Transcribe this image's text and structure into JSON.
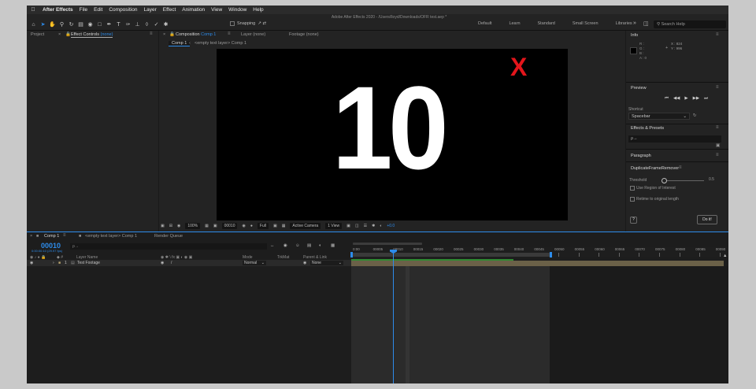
{
  "menubar": {
    "app_name": "After Effects",
    "items": [
      "File",
      "Edit",
      "Composition",
      "Layer",
      "Effect",
      "Animation",
      "View",
      "Window",
      "Help"
    ]
  },
  "window_title": "Adobe After Effects 2020 - /Users/lloyd/Downloads/OFR test.aep *",
  "toolbar": {
    "snapping_label": "Snapping",
    "workspaces": [
      "Default",
      "Learn",
      "Standard",
      "Small Screen",
      "Libraries"
    ],
    "search_placeholder": "Search Help"
  },
  "project_panel": {
    "tab": "Project"
  },
  "effect_controls": {
    "tab_prefix": "Effect Controls",
    "tab_value": "(none)"
  },
  "composition_panel": {
    "tab_prefix": "Composition",
    "tab_value": "Comp 1",
    "layer_tab": "Layer (none)",
    "footage_tab": "Footage (none)",
    "breadcrumb_comp": "Comp 1",
    "breadcrumb_layer": "<empty text layer> Comp 1"
  },
  "viewer": {
    "frame_text": "10",
    "overlay_text": "X",
    "overlay_color": "#e3151b",
    "zoom": "100%",
    "timecode": "00010",
    "resolution": "Full",
    "camera": "Active Camera",
    "views": "1 View",
    "exposure": "+0.0"
  },
  "info_panel": {
    "title": "Info",
    "r": "R :",
    "g": "G :",
    "b": "B :",
    "a": "A : 0",
    "x": "X : 824",
    "y": "Y : 996"
  },
  "preview_panel": {
    "title": "Preview",
    "shortcut_label": "Shortcut",
    "shortcut_value": "Spacebar"
  },
  "effects_presets": {
    "title": "Effects & Presets",
    "search_placeholder": "ρ→"
  },
  "paragraph_panel": {
    "title": "Paragraph",
    "plugin_name": "DuplicateFrameRemover",
    "threshold_label": "Threshold",
    "threshold_value": "0.5",
    "use_roi_label": "Use Region of Interest",
    "retime_label": "Retime to original length",
    "help_button": "?",
    "do_it_button": "Do it!"
  },
  "timeline": {
    "tabs": [
      "Comp 1",
      "<empty text layer> Comp 1",
      "Render Queue"
    ],
    "current_time": "00010",
    "current_time_sub": "0:00:00:10 (29.97 fps)",
    "search_placeholder": "ρ→",
    "columns": {
      "layer_name": "Layer Name",
      "mode": "Mode",
      "trkmat": "TrkMat",
      "parent": "Parent & Link"
    },
    "layers": [
      {
        "number": "1",
        "name": "Test Footage",
        "mode": "Normal",
        "parent": "None"
      }
    ],
    "ruler_labels": [
      "0:00",
      "00005",
      "00010",
      "00015",
      "00020",
      "00025",
      "00030",
      "00035",
      "00040",
      "00045",
      "00050",
      "00055",
      "00060",
      "00065",
      "00070",
      "00075",
      "00080",
      "00085",
      "00090"
    ]
  },
  "colors": {
    "accent": "#2d8ceb",
    "panel_bg": "#232323",
    "layer_bar": "#6b6148",
    "work_area_green": "#2f8a32"
  }
}
